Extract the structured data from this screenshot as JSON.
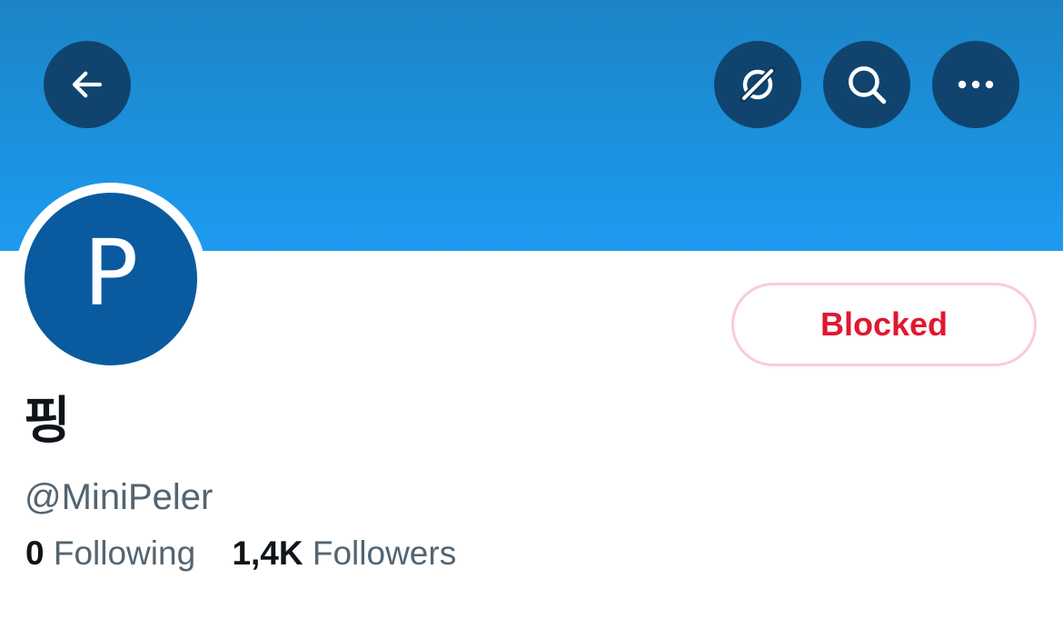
{
  "header": {
    "banner_color": "#1d9bf0",
    "buttons": [
      {
        "icon": "back-arrow-icon"
      },
      {
        "icon": "grok-icon"
      },
      {
        "icon": "search-icon"
      },
      {
        "icon": "more-icon"
      }
    ]
  },
  "profile": {
    "avatar_letter": "P",
    "avatar_color": "#0a5aa0",
    "display_name": "핑",
    "handle": "@MiniPeler",
    "action_button": "Blocked",
    "stats": {
      "following_count": "0",
      "following_label": "Following",
      "followers_count": "1,4K",
      "followers_label": "Followers"
    }
  }
}
